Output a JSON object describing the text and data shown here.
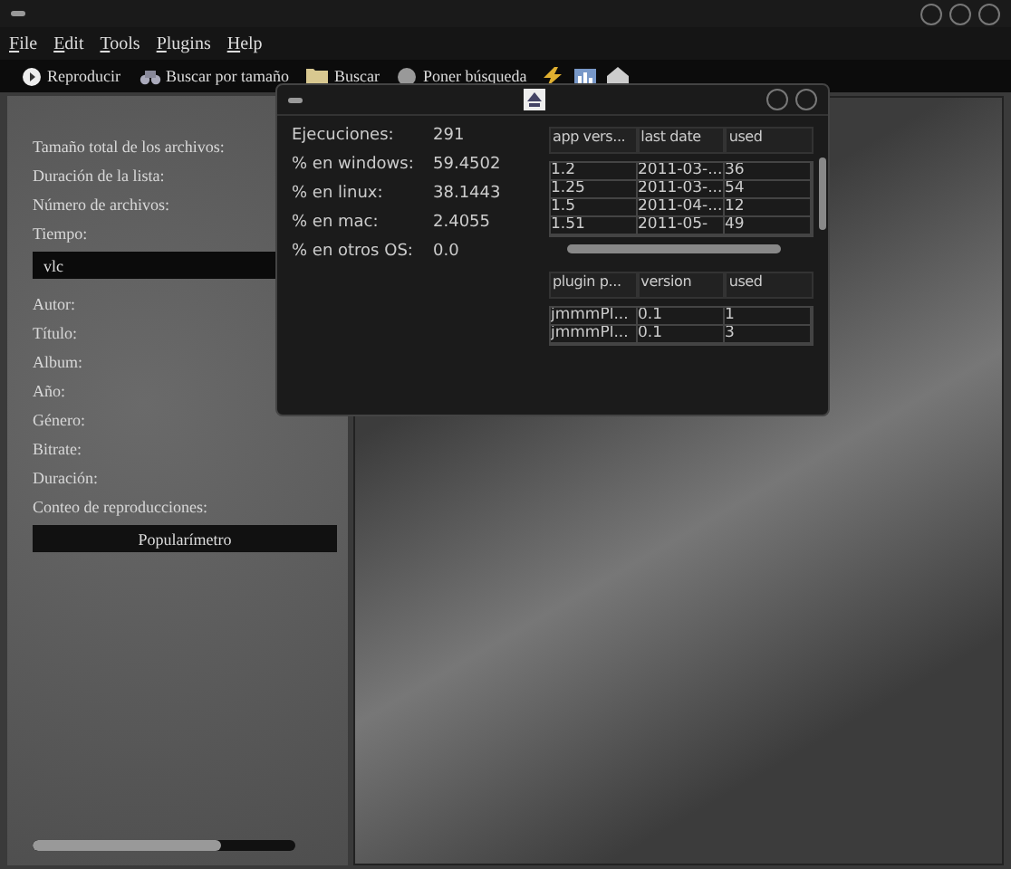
{
  "menu": [
    {
      "label": "File"
    },
    {
      "label": "Edit"
    },
    {
      "label": "Tools"
    },
    {
      "label": "Plugins"
    },
    {
      "label": "Help"
    }
  ],
  "toolbar": [
    {
      "kind": "play",
      "label": "Reproducir"
    },
    {
      "kind": "search",
      "label": "Buscar por tamaño"
    },
    {
      "kind": "folder",
      "label": "Buscar"
    },
    {
      "kind": "disc",
      "label": "Poner búsqueda"
    }
  ],
  "info_labels": [
    "Tamaño total de los archivos:",
    "Duración de la lista:",
    "Número de archivos:",
    "Tiempo:"
  ],
  "search": {
    "value": "vlc"
  },
  "track_labels": [
    "Autor:",
    "Título:",
    "Album:",
    "Año:",
    "Género:",
    "Bitrate:",
    "Duración:",
    "Conteo de reproducciones:"
  ],
  "popularity_button": "Popularímetro",
  "progress": {
    "level": 0.72
  },
  "stats": [
    {
      "label": "Ejecuciones:",
      "value": "291"
    },
    {
      "label": "% en windows:",
      "value": "59.4502"
    },
    {
      "label": "% en linux:",
      "value": "38.1443"
    },
    {
      "label": "% en mac:",
      "value": "2.4055"
    },
    {
      "label": "% en otros OS:",
      "value": "0.0"
    }
  ],
  "versions_table": {
    "columns": [
      "app vers...",
      "last date",
      "used"
    ],
    "rows": [
      [
        "1.2",
        "2011-03-...",
        "36"
      ],
      [
        "1.25",
        "2011-03-...",
        "54"
      ],
      [
        "1.5",
        "2011-04-...",
        "12"
      ],
      [
        "1.51",
        "2011-05-",
        "49"
      ]
    ]
  },
  "plugins_table": {
    "columns": [
      "plugin p...",
      "version",
      "used"
    ],
    "rows": [
      [
        "jmmmPl...",
        "0.1",
        "1"
      ],
      [
        "jmmmPl...",
        "0.1",
        "3"
      ]
    ]
  }
}
